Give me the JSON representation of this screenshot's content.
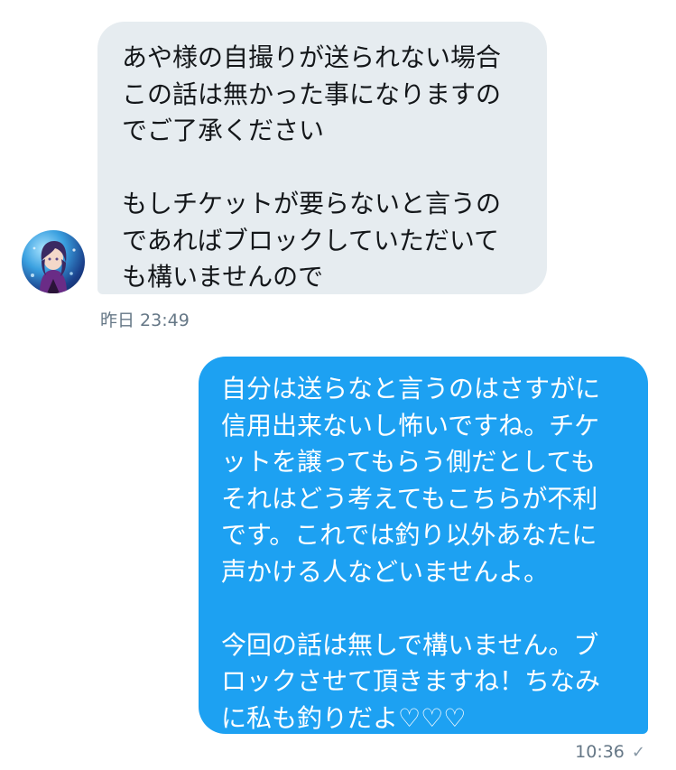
{
  "messages": [
    {
      "direction": "incoming",
      "text": "あや様の自撮りが送られない場合\nこの話は無かった事になりますの\nでご了承ください\n\nもしチケットが要らないと言うの\nであればブロックしていただいて\nも構いませんので",
      "timestamp": "昨日 23:49",
      "avatar_icon": "profile-avatar-icon"
    },
    {
      "direction": "outgoing",
      "text": "自分は送らなと言うのはさすがに\n信用出来ないし怖いですね。チケ\nットを譲ってもらう側だとしても\nそれはどう考えてもこちらが不利\nです。これでは釣り以外あなたに\n声かける人などいませんよ。\n\n今回の話は無しで構いません。ブ\nロックさせて頂きますね！ちなみ\nに私も釣りだよ♡♡♡",
      "timestamp": "10:36",
      "status_icon": "checkmark-icon"
    }
  ],
  "colors": {
    "incoming_bubble": "#e6ecf0",
    "outgoing_bubble": "#1da1f2",
    "incoming_text": "#14171a",
    "outgoing_text": "#ffffff",
    "meta_text": "#657786"
  }
}
